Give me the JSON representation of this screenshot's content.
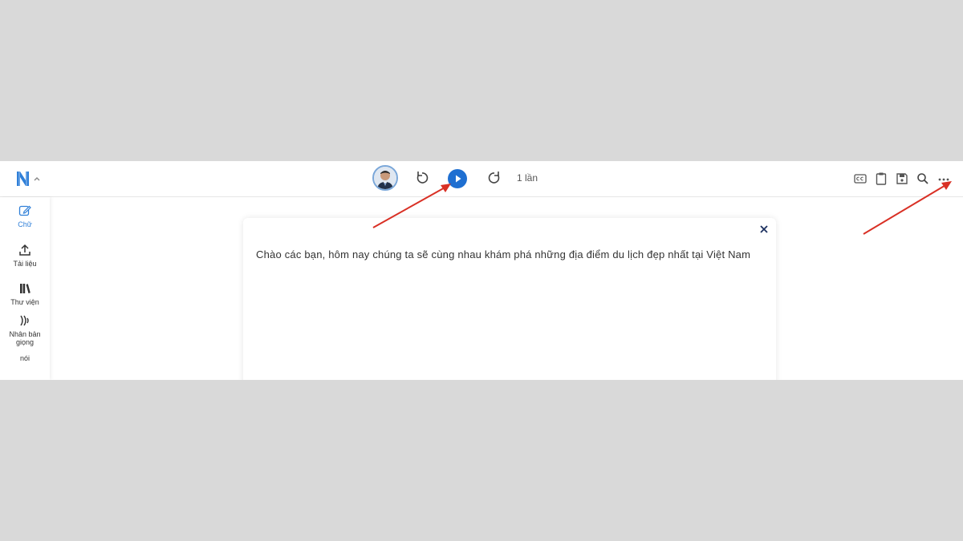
{
  "header": {
    "play_count_label": "1 lần"
  },
  "sidebar": {
    "items": [
      {
        "label": "Chữ",
        "icon": "edit-icon",
        "active": true
      },
      {
        "label": "Tải liệu",
        "icon": "upload-icon",
        "active": false
      },
      {
        "label": "Thư viện",
        "icon": "library-icon",
        "active": false
      },
      {
        "label": "Nhân bản giọng",
        "label2": "nói",
        "icon": "voice-clone-icon",
        "active": false
      }
    ]
  },
  "editor": {
    "text": "Chào các bạn, hôm nay chúng ta sẽ cùng nhau khám phá những địa điểm du lịch đẹp nhất tại Việt Nam"
  },
  "colors": {
    "accent": "#1f6fd1",
    "sidebar_active": "#2f7fd8",
    "annotation_arrow": "#d93025",
    "backdrop": "#d9d9d9"
  }
}
